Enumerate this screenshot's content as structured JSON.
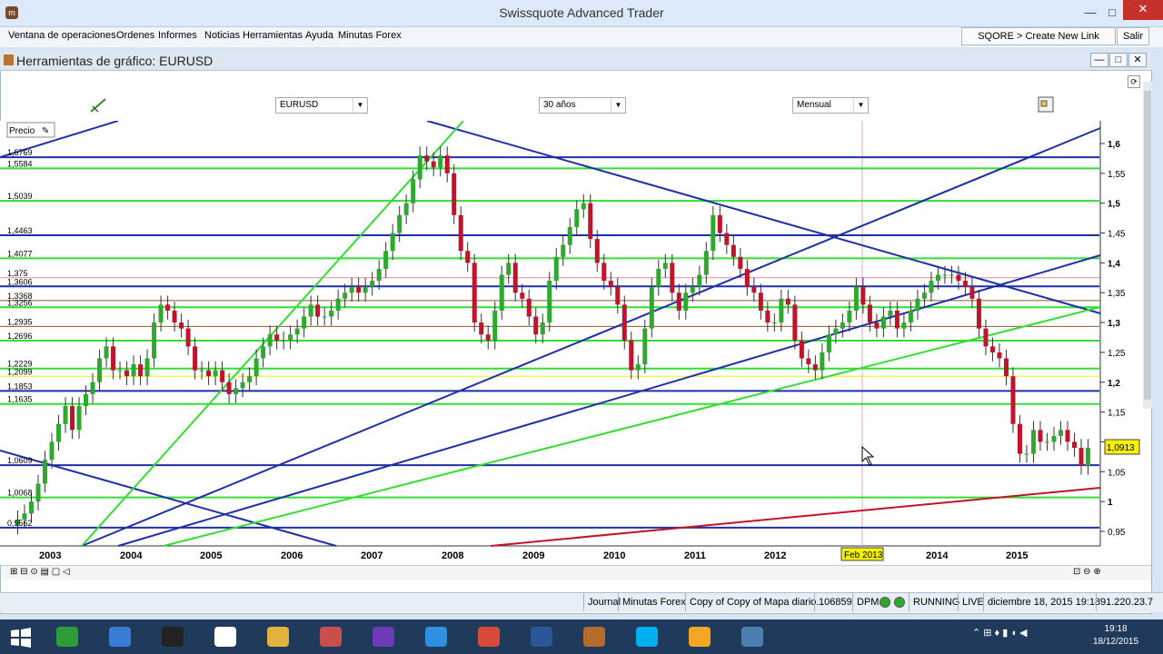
{
  "window": {
    "title": "Swissquote Advanced Trader",
    "minimize": "—",
    "maximize": "□",
    "close": "✕",
    "icon_label": "m"
  },
  "menu": {
    "items": [
      "Ventana de operaciones",
      "Ordenes",
      "Informes",
      "Noticias",
      "Herramientas",
      "Ayuda",
      "Minutas Forex"
    ],
    "create_link": "SQORE > Create New Link",
    "salir": "Salir"
  },
  "chart_window": {
    "title": "Herramientas de gráfico: EURUSD",
    "symbol": "EURUSD",
    "period": "30 años",
    "interval": "Mensual",
    "price_label": "Precio",
    "current_price": "1,0913",
    "crosshair_date": "Feb 2013"
  },
  "chart_data": {
    "type": "candlestick",
    "x_labels": [
      "2003",
      "2004",
      "2005",
      "2006",
      "2007",
      "2008",
      "2009",
      "2010",
      "2011",
      "2012",
      "2014",
      "2015"
    ],
    "y_ticks": [
      "1,6",
      "1,55",
      "1,5",
      "1,45",
      "1,4",
      "1,35",
      "1,3",
      "1,25",
      "1,2",
      "1,15",
      "1,1",
      "1,05",
      "1",
      "0,95"
    ],
    "ylim": [
      0.9,
      1.62
    ],
    "level_labels": [
      "1,5769",
      "1,5584",
      "1,5039",
      "1,4463",
      "1,4077",
      "1,375",
      "1,3606",
      "1,3368",
      "1,3256",
      "1,2935",
      "1,2696",
      "1,2229",
      "1,2099",
      "1,1853",
      "1,1635",
      "1,0609",
      "1,0068",
      "0,9562"
    ],
    "horizontal_levels": [
      {
        "price": 1.5769,
        "color": "#1f2fa6"
      },
      {
        "price": 1.5584,
        "color": "#33dd33"
      },
      {
        "price": 1.5039,
        "color": "#33dd33"
      },
      {
        "price": 1.4463,
        "color": "#1f2fa6"
      },
      {
        "price": 1.4077,
        "color": "#33dd33"
      },
      {
        "price": 1.375,
        "color": "#e48aa0"
      },
      {
        "price": 1.3606,
        "color": "#1f2fa6"
      },
      {
        "price": 1.3368,
        "color": "#8b5a2b"
      },
      {
        "price": 1.3256,
        "color": "#33dd33"
      },
      {
        "price": 1.2935,
        "color": "#8b5a2b"
      },
      {
        "price": 1.2696,
        "color": "#33dd33"
      },
      {
        "price": 1.2229,
        "color": "#33dd33"
      },
      {
        "price": 1.2099,
        "color": "#f2f200"
      },
      {
        "price": 1.1853,
        "color": "#1f2fa6"
      },
      {
        "price": 1.1635,
        "color": "#33dd33"
      },
      {
        "price": 1.0609,
        "color": "#1f2fa6"
      },
      {
        "price": 1.0068,
        "color": "#33dd33"
      },
      {
        "price": 0.9562,
        "color": "#1f2fa6"
      }
    ],
    "colors": {
      "up": "#2ea82e",
      "down": "#c0142c",
      "blue": "#1f2fa6",
      "green": "#33dd33",
      "red": "#c0142c"
    }
  },
  "status": {
    "journal": "Journal",
    "minutas": "Minutas Forex",
    "copy": "Copy of Copy of Mapa diario.",
    "account": "106859",
    "dpm": "DPM",
    "running": "RUNNING",
    "live": "LIVE",
    "datetime": "diciembre 18, 2015 19:18",
    "ip": "91.220.23.7"
  },
  "taskbar": {
    "time": "19:18",
    "date": "18/12/2015",
    "apps": [
      {
        "name": "store",
        "color": "#2d9d3a"
      },
      {
        "name": "rocket",
        "color": "#3a7bd5"
      },
      {
        "name": "media",
        "color": "#222222"
      },
      {
        "name": "hp",
        "color": "#ffffff"
      },
      {
        "name": "explorer",
        "color": "#e2b33c"
      },
      {
        "name": "snipping",
        "color": "#c94f4f"
      },
      {
        "name": "photos",
        "color": "#6e3bb8"
      },
      {
        "name": "ie",
        "color": "#2f8fe0"
      },
      {
        "name": "chrome",
        "color": "#d74a3a"
      },
      {
        "name": "word",
        "color": "#2b5797"
      },
      {
        "name": "trader",
        "color": "#b56b2b"
      },
      {
        "name": "skype",
        "color": "#00aff0"
      },
      {
        "name": "flower",
        "color": "#f5a623"
      },
      {
        "name": "screen",
        "color": "#4a7fb0"
      }
    ]
  }
}
